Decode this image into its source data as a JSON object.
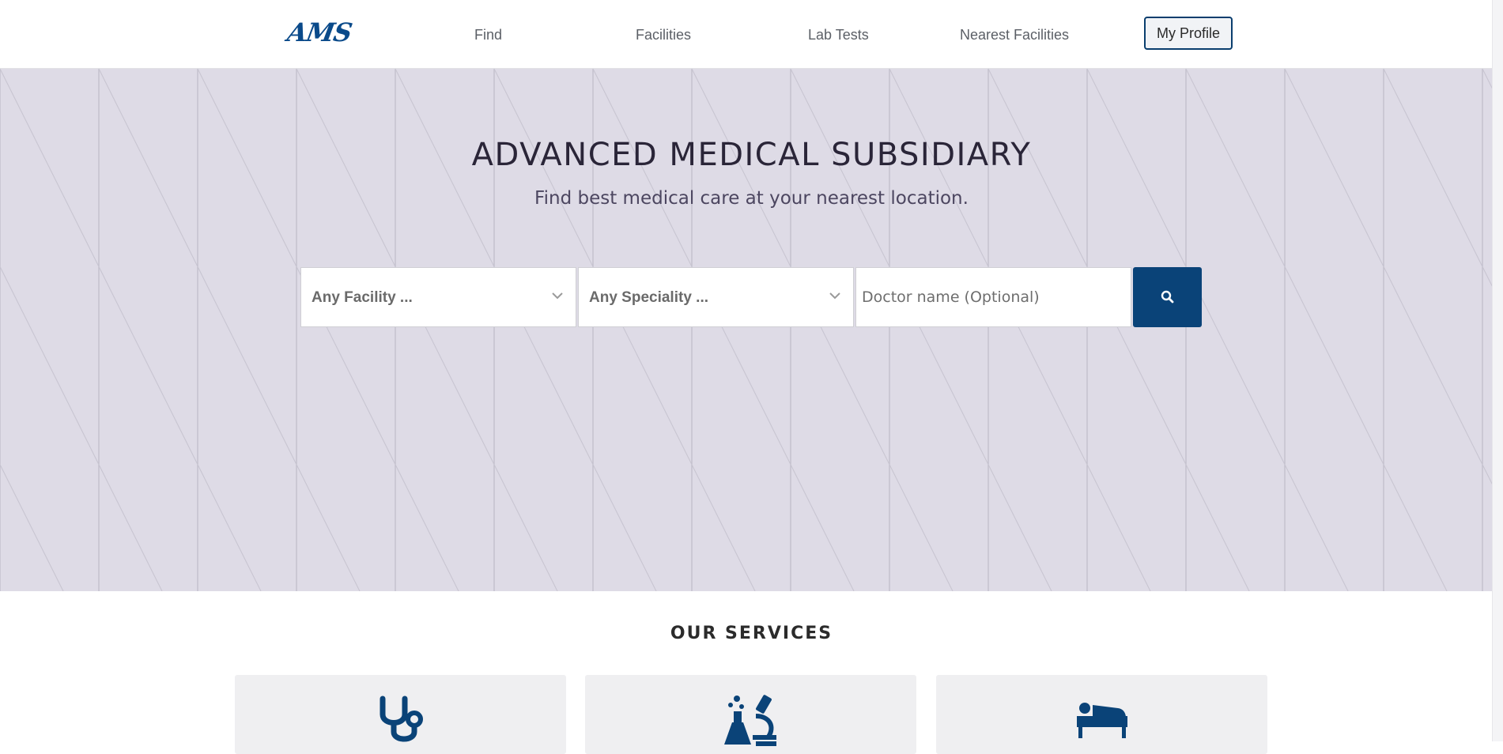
{
  "header": {
    "logo": "AMS",
    "nav": [
      {
        "label": "Find"
      },
      {
        "label": "Facilities"
      },
      {
        "label": "Lab Tests"
      },
      {
        "label": "Nearest Facilities"
      }
    ],
    "profile_button": "My Profile"
  },
  "hero": {
    "title": "ADVANCED MEDICAL SUBSIDIARY",
    "subtitle": "Find best medical care at your nearest location.",
    "search": {
      "facility_select": "Any Facility ...",
      "speciality_select": "Any Speciality ...",
      "doctor_placeholder": "Doctor name (Optional)",
      "button_icon": "search-icon"
    }
  },
  "services": {
    "title": "OUR SERVICES",
    "cards": [
      {
        "icon": "stethoscope-icon"
      },
      {
        "icon": "lab-microscope-icon"
      },
      {
        "icon": "hospital-bed-icon"
      }
    ]
  },
  "colors": {
    "brand": "#0a4378",
    "hero_bg": "#dedbe6",
    "card_bg": "#efeff1"
  }
}
